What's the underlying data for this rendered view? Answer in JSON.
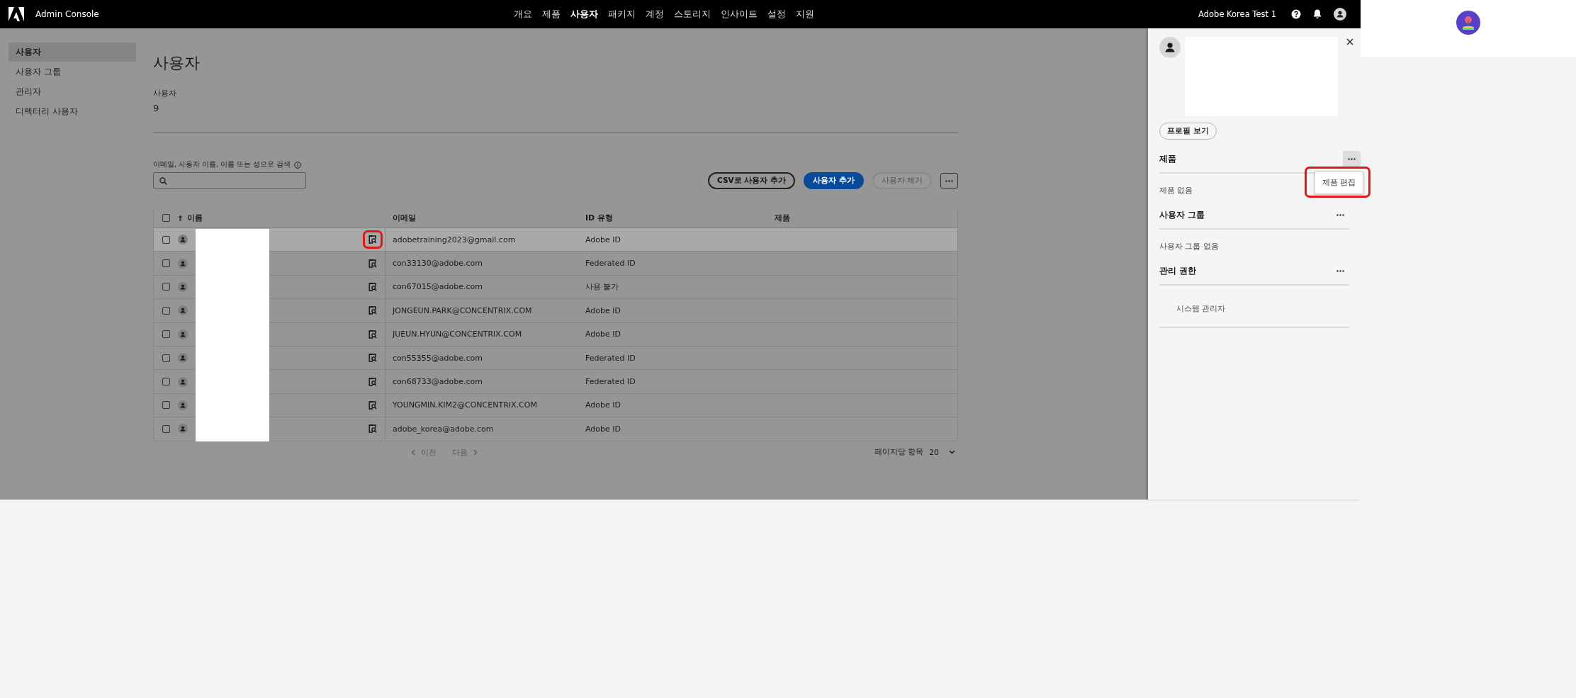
{
  "topbar": {
    "product": "Admin Console",
    "org": "Adobe Korea Test 1",
    "nav": [
      {
        "label": "개요",
        "selected": false
      },
      {
        "label": "제품",
        "selected": false
      },
      {
        "label": "사용자",
        "selected": true
      },
      {
        "label": "패키지",
        "selected": false
      },
      {
        "label": "계정",
        "selected": false
      },
      {
        "label": "스토리지",
        "selected": false
      },
      {
        "label": "인사이트",
        "selected": false
      },
      {
        "label": "설정",
        "selected": false
      },
      {
        "label": "지원",
        "selected": false
      }
    ]
  },
  "sidebar": {
    "items": [
      {
        "label": "사용자",
        "selected": true
      },
      {
        "label": "사용자 그룹",
        "selected": false
      },
      {
        "label": "관리자",
        "selected": false
      },
      {
        "label": "디렉터리 사용자",
        "selected": false
      }
    ]
  },
  "page": {
    "title": "사용자",
    "stat_label": "사용자",
    "stat_value": "9"
  },
  "search": {
    "label": "이메일, 사용자 이름, 이름 또는 성으로 검색"
  },
  "actions": [
    {
      "label": "CSV로 사용자 추가",
      "kind": "outline",
      "disabled": false
    },
    {
      "label": "사용자 추가",
      "kind": "primary",
      "disabled": false
    },
    {
      "label": "사용자 제거",
      "kind": "outline",
      "disabled": true
    }
  ],
  "table": {
    "all_checked": false,
    "columns": [
      {
        "label": "이름",
        "sorted": true
      },
      {
        "label": "이메일",
        "sorted": false
      },
      {
        "label": "ID 유형",
        "sorted": false
      },
      {
        "label": "제품",
        "sorted": false
      }
    ],
    "rows": [
      {
        "email": "adobetraining2023@gmail.com",
        "id_type": "Adobe ID",
        "selected": true,
        "highlighted": true
      },
      {
        "email": "con33130@adobe.com",
        "id_type": "Federated ID",
        "selected": false,
        "highlighted": false
      },
      {
        "email": "con67015@adobe.com",
        "id_type": "사용 불가",
        "selected": false,
        "highlighted": false
      },
      {
        "email": "JONGEUN.PARK@CONCENTRIX.COM",
        "id_type": "Adobe ID",
        "selected": false,
        "highlighted": false
      },
      {
        "email": "JUEUN.HYUN@CONCENTRIX.COM",
        "id_type": "Adobe ID",
        "selected": false,
        "highlighted": false
      },
      {
        "email": "con55355@adobe.com",
        "id_type": "Federated ID",
        "selected": false,
        "highlighted": false
      },
      {
        "email": "con68733@adobe.com",
        "id_type": "Federated ID",
        "selected": false,
        "highlighted": false
      },
      {
        "email": "YOUNGMIN.KIM2@CONCENTRIX.COM",
        "id_type": "Adobe ID",
        "selected": false,
        "highlighted": false
      },
      {
        "email": "adobe_korea@adobe.com",
        "id_type": "Adobe ID",
        "selected": false,
        "highlighted": false
      }
    ]
  },
  "pagination": {
    "prev": "이전",
    "next": "다음",
    "per_page_label": "페이지당 항목",
    "per_page": "20"
  },
  "panel": {
    "profile_button": "프로필 보기",
    "sections": [
      {
        "title": "제품",
        "empty_text": "제품 없음",
        "menu_open": true,
        "menu": [
          {
            "label": "제품 편집",
            "highlighted": true
          }
        ]
      },
      {
        "title": "사용자 그룹",
        "empty_text": "사용자 그룹 없음",
        "menu_open": false
      },
      {
        "title": "관리 권한",
        "items": [
          "시스템 관리자"
        ],
        "menu_open": false
      }
    ]
  }
}
